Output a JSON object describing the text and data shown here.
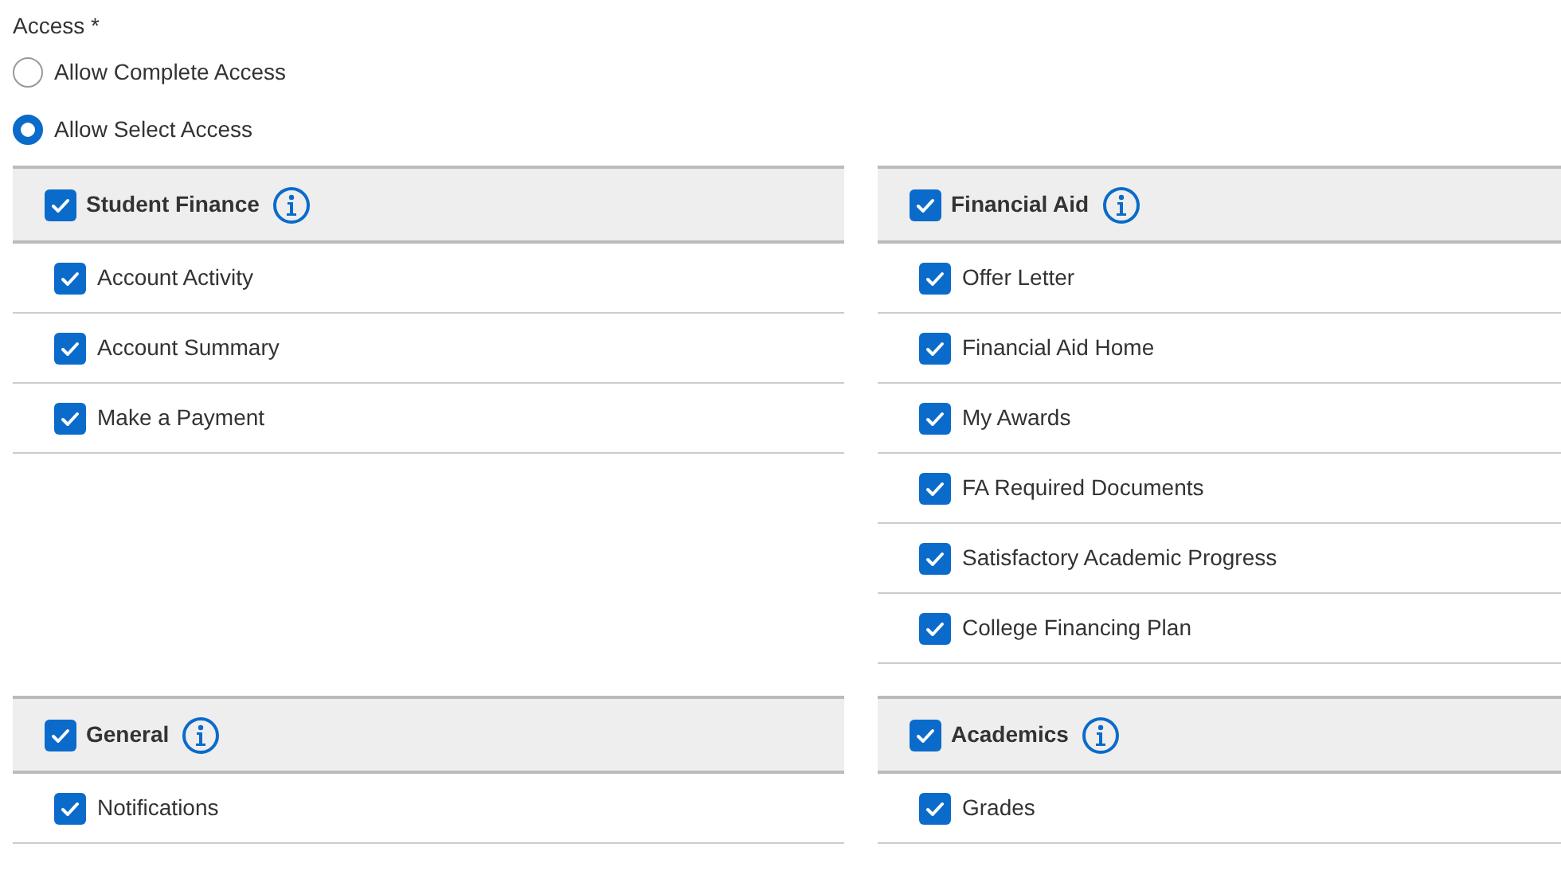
{
  "access": {
    "label": "Access *",
    "options": [
      {
        "label": "Allow Complete Access",
        "selected": false
      },
      {
        "label": "Allow Select Access",
        "selected": true
      }
    ]
  },
  "sections": [
    {
      "title": "Student Finance",
      "checked": true,
      "items": [
        {
          "label": "Account Activity",
          "checked": true
        },
        {
          "label": "Account Summary",
          "checked": true
        },
        {
          "label": "Make a Payment",
          "checked": true
        }
      ]
    },
    {
      "title": "Financial Aid",
      "checked": true,
      "items": [
        {
          "label": "Offer Letter",
          "checked": true
        },
        {
          "label": "Financial Aid Home",
          "checked": true
        },
        {
          "label": "My Awards",
          "checked": true
        },
        {
          "label": "FA Required Documents",
          "checked": true
        },
        {
          "label": "Satisfactory Academic Progress",
          "checked": true
        },
        {
          "label": "College Financing Plan",
          "checked": true
        }
      ]
    },
    {
      "title": "General",
      "checked": true,
      "items": [
        {
          "label": "Notifications",
          "checked": true
        }
      ]
    },
    {
      "title": "Academics",
      "checked": true,
      "items": [
        {
          "label": "Grades",
          "checked": true
        }
      ]
    }
  ]
}
